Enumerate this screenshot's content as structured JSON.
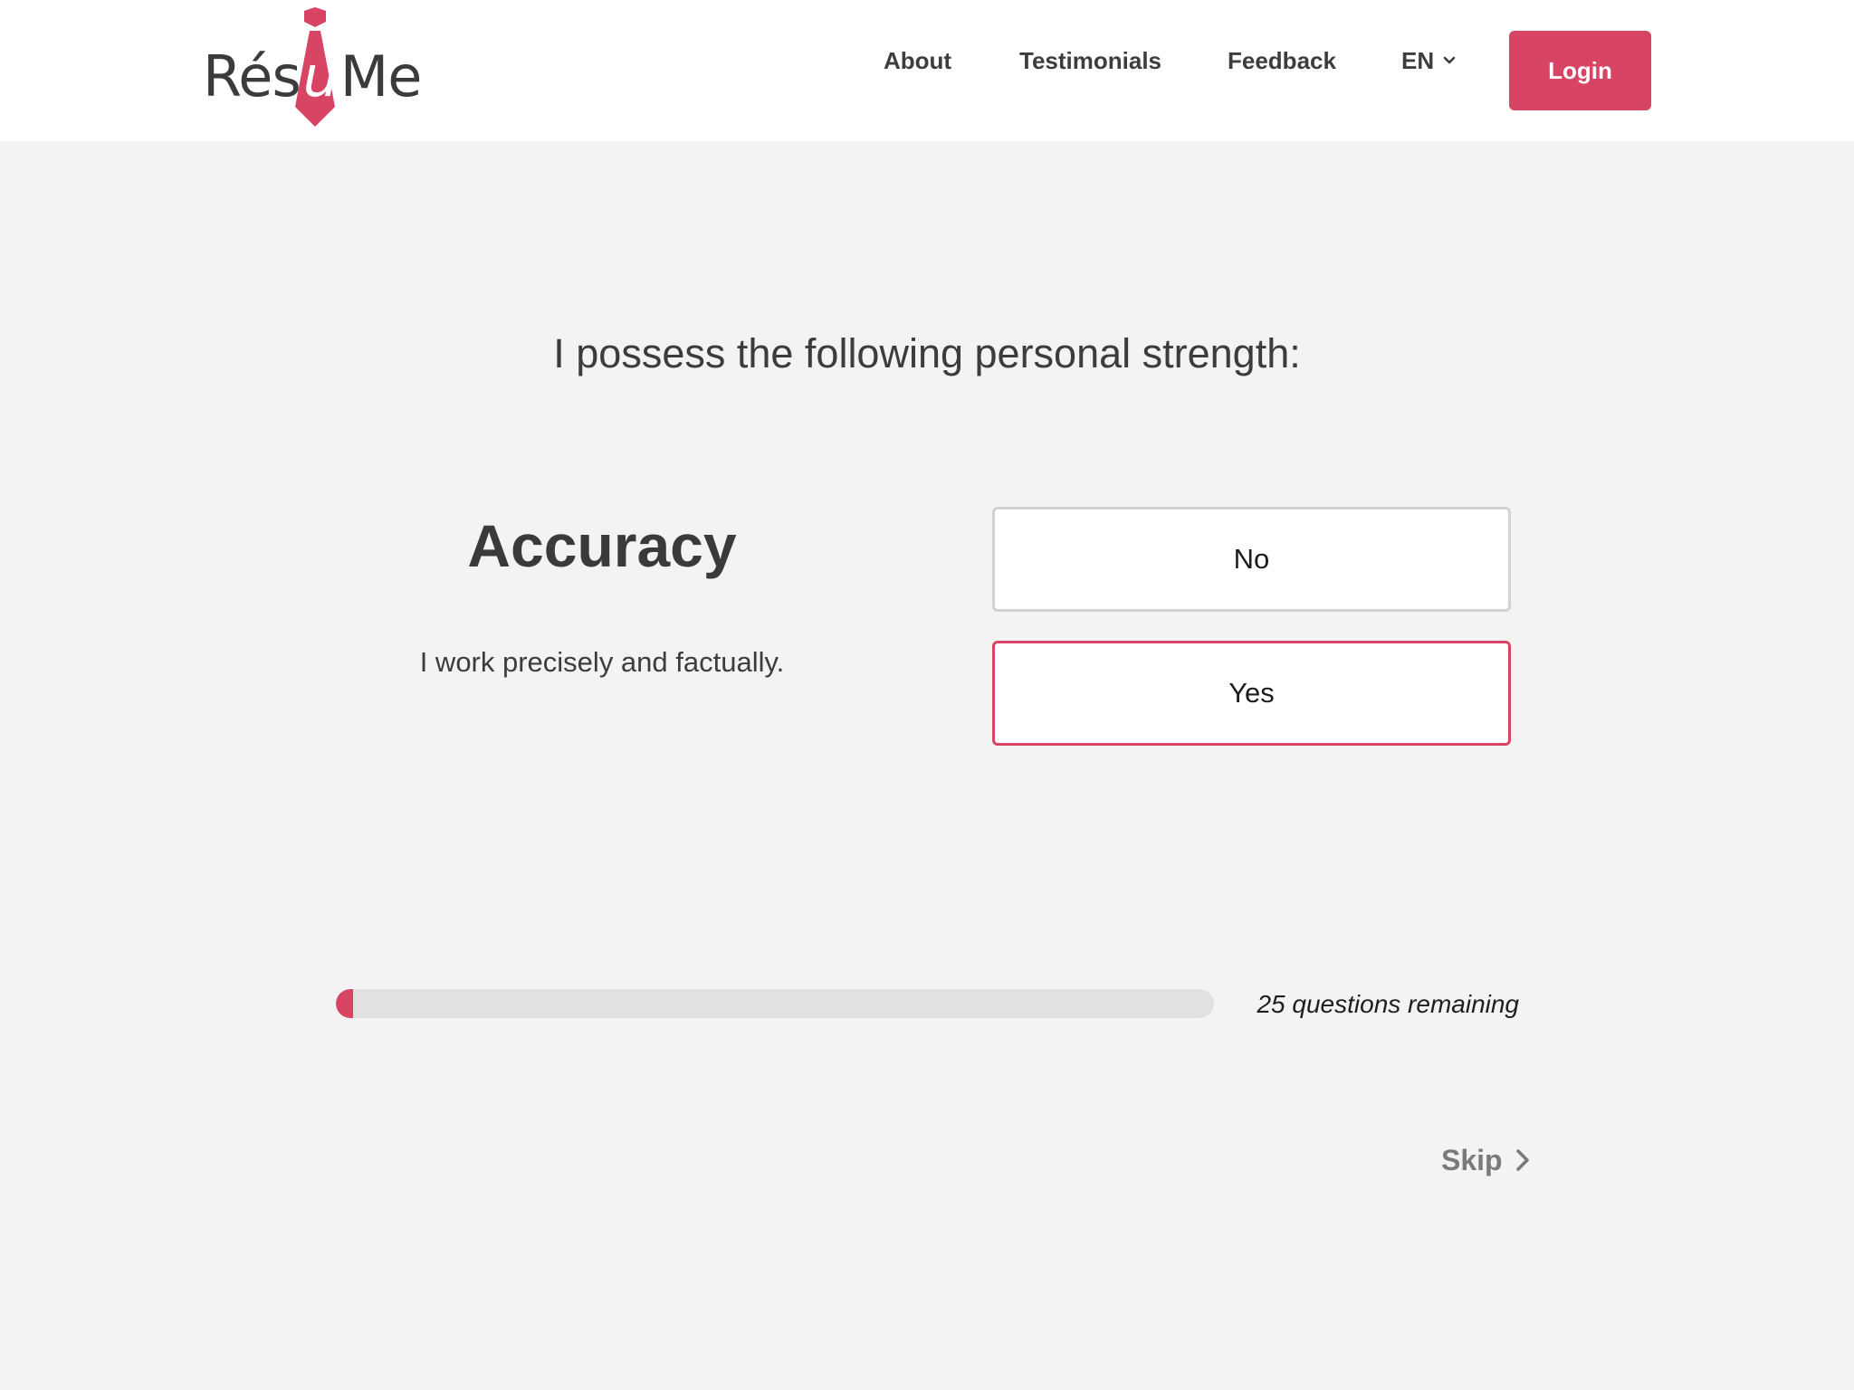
{
  "header": {
    "logo": {
      "text_before": "Rés",
      "text_tie": "u",
      "text_after": "Me"
    },
    "nav": {
      "about": "About",
      "testimonials": "Testimonials",
      "feedback": "Feedback",
      "language": "EN",
      "language_icon": "chevron-down-icon"
    },
    "login_label": "Login"
  },
  "question": {
    "prompt": "I possess the following personal strength:",
    "strength_title": "Accuracy",
    "strength_description": "I work precisely and factually.",
    "answers": {
      "no": "No",
      "yes": "Yes"
    },
    "selected_answer": "yes"
  },
  "progress": {
    "remaining_text": "25 questions remaining",
    "fraction_complete": 0.02
  },
  "skip": {
    "label": "Skip",
    "icon": "chevron-right-icon"
  },
  "colors": {
    "accent": "#d84464",
    "background": "#f3f3f3",
    "header_background": "#ffffff",
    "text": "#3a3a3a",
    "border_default": "#d2d2d2"
  }
}
